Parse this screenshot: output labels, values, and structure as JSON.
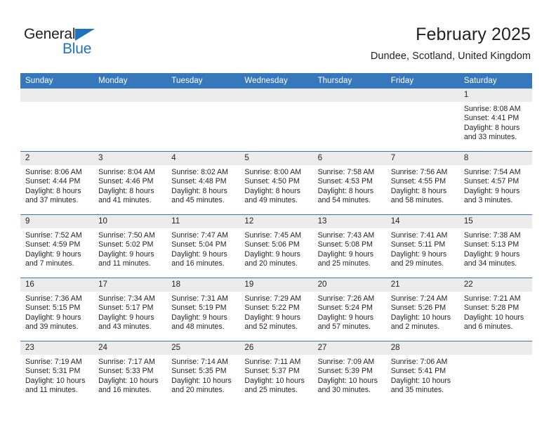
{
  "brand": {
    "name_part1": "General",
    "name_part2": "Blue",
    "accent_color": "#1f72bb",
    "triangle_icon": "triangle-icon"
  },
  "header": {
    "title": "February 2025",
    "subtitle": "Dundee, Scotland, United Kingdom"
  },
  "calendar": {
    "header_bg": "#3678bb",
    "daynum_bg": "#ececec",
    "weekday_headers": [
      "Sunday",
      "Monday",
      "Tuesday",
      "Wednesday",
      "Thursday",
      "Friday",
      "Saturday"
    ],
    "weeks": [
      [
        {
          "day": "",
          "empty": true,
          "details": ""
        },
        {
          "day": "",
          "empty": true,
          "details": ""
        },
        {
          "day": "",
          "empty": true,
          "details": ""
        },
        {
          "day": "",
          "empty": true,
          "details": ""
        },
        {
          "day": "",
          "empty": true,
          "details": ""
        },
        {
          "day": "",
          "empty": true,
          "details": ""
        },
        {
          "day": "1",
          "empty": false,
          "details": "Sunrise: 8:08 AM\nSunset: 4:41 PM\nDaylight: 8 hours\nand 33 minutes."
        }
      ],
      [
        {
          "day": "2",
          "empty": false,
          "details": "Sunrise: 8:06 AM\nSunset: 4:44 PM\nDaylight: 8 hours\nand 37 minutes."
        },
        {
          "day": "3",
          "empty": false,
          "details": "Sunrise: 8:04 AM\nSunset: 4:46 PM\nDaylight: 8 hours\nand 41 minutes."
        },
        {
          "day": "4",
          "empty": false,
          "details": "Sunrise: 8:02 AM\nSunset: 4:48 PM\nDaylight: 8 hours\nand 45 minutes."
        },
        {
          "day": "5",
          "empty": false,
          "details": "Sunrise: 8:00 AM\nSunset: 4:50 PM\nDaylight: 8 hours\nand 49 minutes."
        },
        {
          "day": "6",
          "empty": false,
          "details": "Sunrise: 7:58 AM\nSunset: 4:53 PM\nDaylight: 8 hours\nand 54 minutes."
        },
        {
          "day": "7",
          "empty": false,
          "details": "Sunrise: 7:56 AM\nSunset: 4:55 PM\nDaylight: 8 hours\nand 58 minutes."
        },
        {
          "day": "8",
          "empty": false,
          "details": "Sunrise: 7:54 AM\nSunset: 4:57 PM\nDaylight: 9 hours\nand 3 minutes."
        }
      ],
      [
        {
          "day": "9",
          "empty": false,
          "details": "Sunrise: 7:52 AM\nSunset: 4:59 PM\nDaylight: 9 hours\nand 7 minutes."
        },
        {
          "day": "10",
          "empty": false,
          "details": "Sunrise: 7:50 AM\nSunset: 5:02 PM\nDaylight: 9 hours\nand 11 minutes."
        },
        {
          "day": "11",
          "empty": false,
          "details": "Sunrise: 7:47 AM\nSunset: 5:04 PM\nDaylight: 9 hours\nand 16 minutes."
        },
        {
          "day": "12",
          "empty": false,
          "details": "Sunrise: 7:45 AM\nSunset: 5:06 PM\nDaylight: 9 hours\nand 20 minutes."
        },
        {
          "day": "13",
          "empty": false,
          "details": "Sunrise: 7:43 AM\nSunset: 5:08 PM\nDaylight: 9 hours\nand 25 minutes."
        },
        {
          "day": "14",
          "empty": false,
          "details": "Sunrise: 7:41 AM\nSunset: 5:11 PM\nDaylight: 9 hours\nand 29 minutes."
        },
        {
          "day": "15",
          "empty": false,
          "details": "Sunrise: 7:38 AM\nSunset: 5:13 PM\nDaylight: 9 hours\nand 34 minutes."
        }
      ],
      [
        {
          "day": "16",
          "empty": false,
          "details": "Sunrise: 7:36 AM\nSunset: 5:15 PM\nDaylight: 9 hours\nand 39 minutes."
        },
        {
          "day": "17",
          "empty": false,
          "details": "Sunrise: 7:34 AM\nSunset: 5:17 PM\nDaylight: 9 hours\nand 43 minutes."
        },
        {
          "day": "18",
          "empty": false,
          "details": "Sunrise: 7:31 AM\nSunset: 5:19 PM\nDaylight: 9 hours\nand 48 minutes."
        },
        {
          "day": "19",
          "empty": false,
          "details": "Sunrise: 7:29 AM\nSunset: 5:22 PM\nDaylight: 9 hours\nand 52 minutes."
        },
        {
          "day": "20",
          "empty": false,
          "details": "Sunrise: 7:26 AM\nSunset: 5:24 PM\nDaylight: 9 hours\nand 57 minutes."
        },
        {
          "day": "21",
          "empty": false,
          "details": "Sunrise: 7:24 AM\nSunset: 5:26 PM\nDaylight: 10 hours\nand 2 minutes."
        },
        {
          "day": "22",
          "empty": false,
          "details": "Sunrise: 7:21 AM\nSunset: 5:28 PM\nDaylight: 10 hours\nand 6 minutes."
        }
      ],
      [
        {
          "day": "23",
          "empty": false,
          "details": "Sunrise: 7:19 AM\nSunset: 5:31 PM\nDaylight: 10 hours\nand 11 minutes."
        },
        {
          "day": "24",
          "empty": false,
          "details": "Sunrise: 7:17 AM\nSunset: 5:33 PM\nDaylight: 10 hours\nand 16 minutes."
        },
        {
          "day": "25",
          "empty": false,
          "details": "Sunrise: 7:14 AM\nSunset: 5:35 PM\nDaylight: 10 hours\nand 20 minutes."
        },
        {
          "day": "26",
          "empty": false,
          "details": "Sunrise: 7:11 AM\nSunset: 5:37 PM\nDaylight: 10 hours\nand 25 minutes."
        },
        {
          "day": "27",
          "empty": false,
          "details": "Sunrise: 7:09 AM\nSunset: 5:39 PM\nDaylight: 10 hours\nand 30 minutes."
        },
        {
          "day": "28",
          "empty": false,
          "details": "Sunrise: 7:06 AM\nSunset: 5:41 PM\nDaylight: 10 hours\nand 35 minutes."
        },
        {
          "day": "",
          "empty": true,
          "details": ""
        }
      ]
    ]
  }
}
